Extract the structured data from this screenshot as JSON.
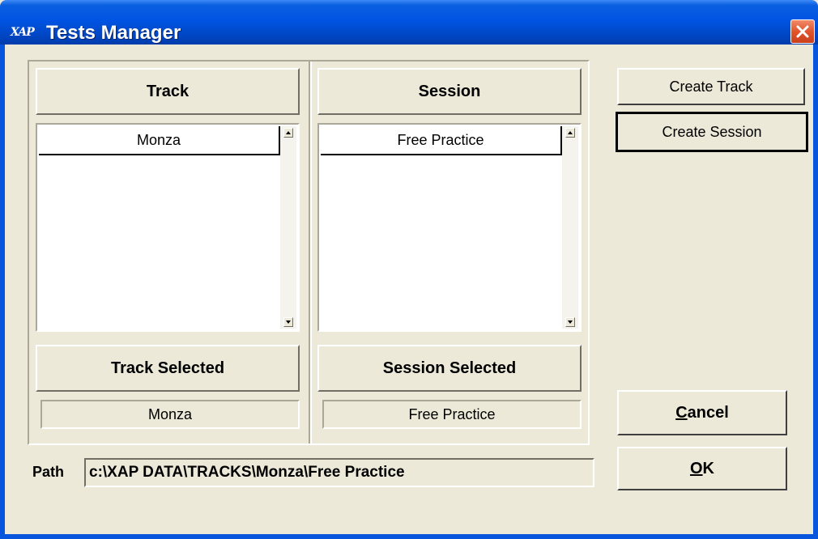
{
  "window": {
    "title": "Tests Manager",
    "icon_label": "XAP",
    "colors": {
      "titlebar": "#0054e3",
      "face": "#ece9d8",
      "close": "#e2542b"
    }
  },
  "track_panel": {
    "header": "Track",
    "items": [
      "Monza"
    ],
    "selected_header": "Track Selected",
    "selected_value": "Monza"
  },
  "session_panel": {
    "header": "Session",
    "items": [
      "Free Practice"
    ],
    "selected_header": "Session Selected",
    "selected_value": "Free Practice"
  },
  "buttons": {
    "create_track": "Create Track",
    "create_session": "Create Session",
    "cancel_first": "C",
    "cancel_rest": "ancel",
    "ok_first": "O",
    "ok_rest": "K"
  },
  "path": {
    "label": "Path",
    "value": "c:\\XAP DATA\\TRACKS\\Monza\\Free Practice"
  },
  "icons": {
    "close": "close-x-icon",
    "scroll_up": "arrow-up-icon",
    "scroll_down": "arrow-down-icon"
  }
}
